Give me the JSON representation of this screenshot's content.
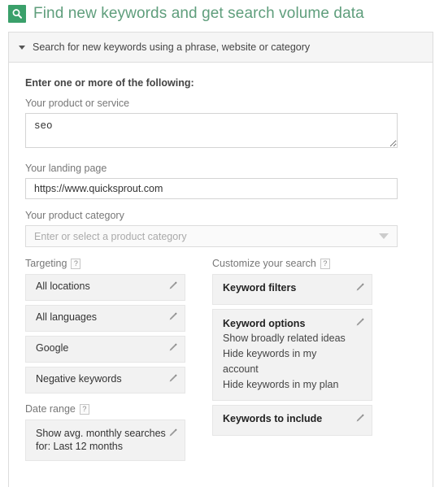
{
  "page": {
    "title": "Find new keywords and get search volume data",
    "title_icon": "search-icon",
    "title_color": "#5f9e7c",
    "icon_bg_color": "#3aa06a"
  },
  "panel": {
    "header_label": "Search for new keywords using a phrase, website or category",
    "disclosure_icon": "chevron-down-icon",
    "form": {
      "heading": "Enter one or more of the following:",
      "product_or_service": {
        "label": "Your product or service",
        "value": "seo",
        "placeholder": ""
      },
      "landing_page": {
        "label": "Your landing page",
        "value": "https://www.quicksprout.com",
        "placeholder": ""
      },
      "product_category": {
        "label": "Your product category",
        "value": "",
        "placeholder": "Enter or select a product category",
        "dropdown_icon": "chevron-down-icon"
      }
    },
    "targeting": {
      "label": "Targeting",
      "help_icon": "?",
      "rows": [
        {
          "text": "All locations",
          "edit_icon": "pencil-icon"
        },
        {
          "text": "All languages",
          "edit_icon": "pencil-icon"
        },
        {
          "text": "Google",
          "edit_icon": "pencil-icon"
        },
        {
          "text": "Negative keywords",
          "edit_icon": "pencil-icon"
        }
      ]
    },
    "date_range": {
      "label": "Date range",
      "help_icon": "?",
      "line1": "Show avg. monthly searches",
      "line2": "for: Last 12 months",
      "edit_icon": "pencil-icon"
    },
    "customize": {
      "label": "Customize your search",
      "help_icon": "?",
      "keyword_filters": {
        "title": "Keyword filters",
        "edit_icon": "pencil-icon"
      },
      "keyword_options": {
        "title": "Keyword options",
        "edit_icon": "pencil-icon",
        "items": [
          "Show broadly related ideas",
          "Hide keywords in my account",
          "Hide keywords in my plan"
        ]
      },
      "keywords_to_include": {
        "title": "Keywords to include",
        "edit_icon": "pencil-icon"
      }
    }
  }
}
